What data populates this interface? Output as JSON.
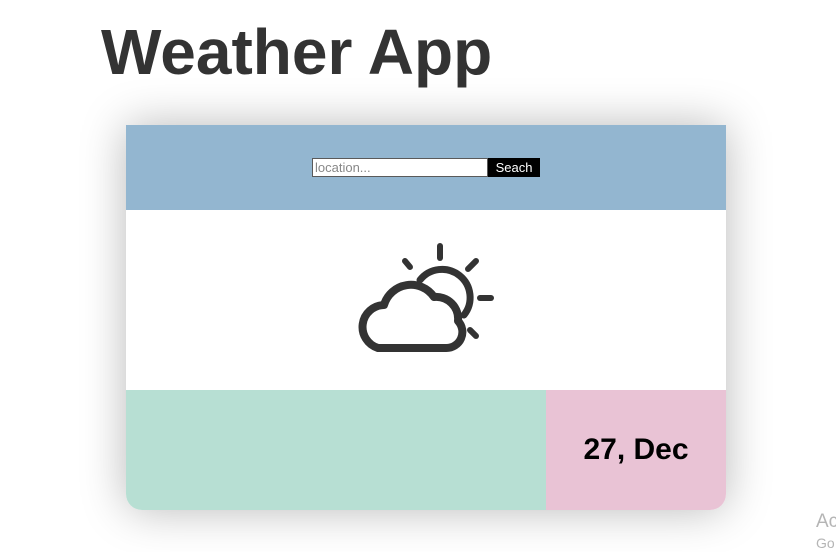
{
  "page": {
    "title": "Weather App"
  },
  "search": {
    "placeholder": "location...",
    "value": "",
    "button_label": "Seach"
  },
  "weather": {
    "icon": "partly-cloudy-icon"
  },
  "info_panel": {
    "text": ""
  },
  "date": {
    "label": "27, Dec"
  },
  "watermark": {
    "line1": "Ac",
    "line2": "Go"
  },
  "colors": {
    "title": "#333333",
    "search_bar_bg": "#93b6d0",
    "info_panel_bg": "#b7dfd3",
    "date_panel_bg": "#e9c3d5",
    "search_button_bg": "#000000",
    "icon_stroke": "#333333"
  }
}
